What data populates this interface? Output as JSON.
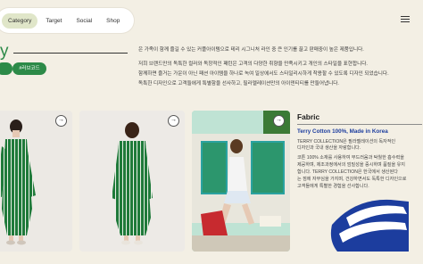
{
  "nav": {
    "items": [
      "Category",
      "Target",
      "Social",
      "Shop"
    ],
    "active_index": 0
  },
  "heading": {
    "partial_letter": "y"
  },
  "tags": [
    "",
    "#러브코드"
  ],
  "intro_lines": [
    "은 가족이 함께 즐길 수 있는 커플아이템으로 테리 시그니처 라인 중 큰 인기를 끌고 판매중이 높은 제품입니다.",
    "저희 브랜드만의 독특한 컬러와 독창적인 패턴은 고객의 다양한 취향을 만족시키고 개인의 스타일을 표현합니다.",
    "함께하면 즐거는 가운이 아닌 패션 아이템을 하나로 녹여 일상에서도 스타일리시하게 착용할 수 있도록 디자인 되었습니다.",
    "독특한 디자인으로 고객들에게 특별함을 선사하고, 필라멜레이션만의 아이덴티티를 만들어냅니다."
  ],
  "product_cards": [
    {
      "arrow": "→"
    },
    {
      "arrow": "→"
    },
    {
      "arrow": "→"
    }
  ],
  "fabric": {
    "title": "Fabric",
    "subtitle": "Terry Cotton 100%, Made in Korea",
    "lines": [
      "TERRY COLLECTION은 필라멜레이션의 독자적인",
      "디자인과 국내 생산을 자랑합니다.",
      "코튼 100% 소재를 사용하여 부드러움과 탁월한 흡수력을",
      "제공하며, 제조과정에서의 엄밀성을 중시하며 품질을 유지",
      "합니다. TERRY COLLECTION은 한국에서 생산된다",
      "는 점에 자부심을 가지며, 건강하면서도 독특한 디자인으로",
      "고객들에게 특별한 경험을 선사합니다."
    ]
  },
  "colors": {
    "background": "#f3efe4",
    "accent_green": "#2c8a48",
    "accent_blue": "#1c3d9e",
    "nav_active": "#e0e6c9"
  },
  "icons": {
    "menu": "menu-icon",
    "arrow": "arrow-right-icon"
  }
}
